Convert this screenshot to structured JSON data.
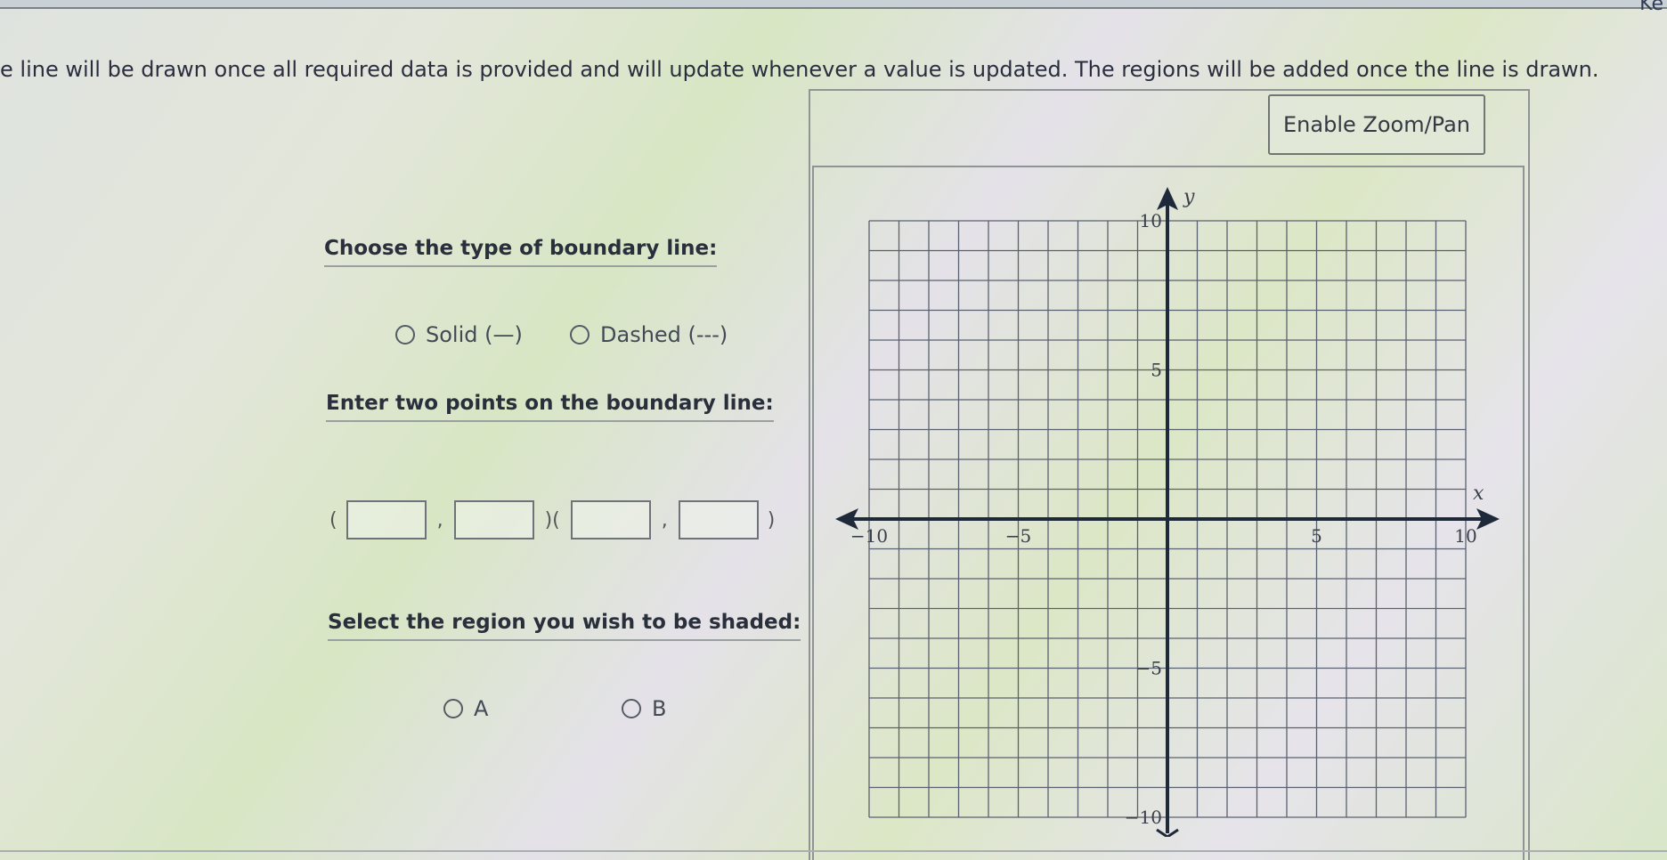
{
  "header": {
    "corner_text": "Ke",
    "instruction": "e line will be drawn once all required data is provided and will update whenever a value is updated. The regions will be added once the line is drawn."
  },
  "boundary_type": {
    "title": "Choose the type of boundary line:",
    "options": [
      {
        "label": "Solid (—)",
        "selected": false
      },
      {
        "label": "Dashed (---)",
        "selected": false
      }
    ]
  },
  "points": {
    "title": "Enter two points on the boundary line:",
    "open_paren": "(",
    "comma": ",",
    "close_open": ")(",
    "close_paren": ")",
    "values": {
      "x1": "",
      "y1": "",
      "x2": "",
      "y2": ""
    }
  },
  "region": {
    "title": "Select the region you wish to be shaded:",
    "options": [
      {
        "label": "A",
        "selected": false
      },
      {
        "label": "B",
        "selected": false
      }
    ]
  },
  "graph": {
    "zoom_button": "Enable Zoom/Pan",
    "x_axis_label": "x",
    "y_axis_label": "y",
    "x_range": [
      -10,
      10
    ],
    "y_range": [
      -10,
      10
    ],
    "grid_step": 1,
    "x_tick_labels": [
      "-10",
      "-5",
      "5",
      "10"
    ],
    "y_tick_labels": [
      "10",
      "5",
      "-5",
      "-10"
    ]
  }
}
